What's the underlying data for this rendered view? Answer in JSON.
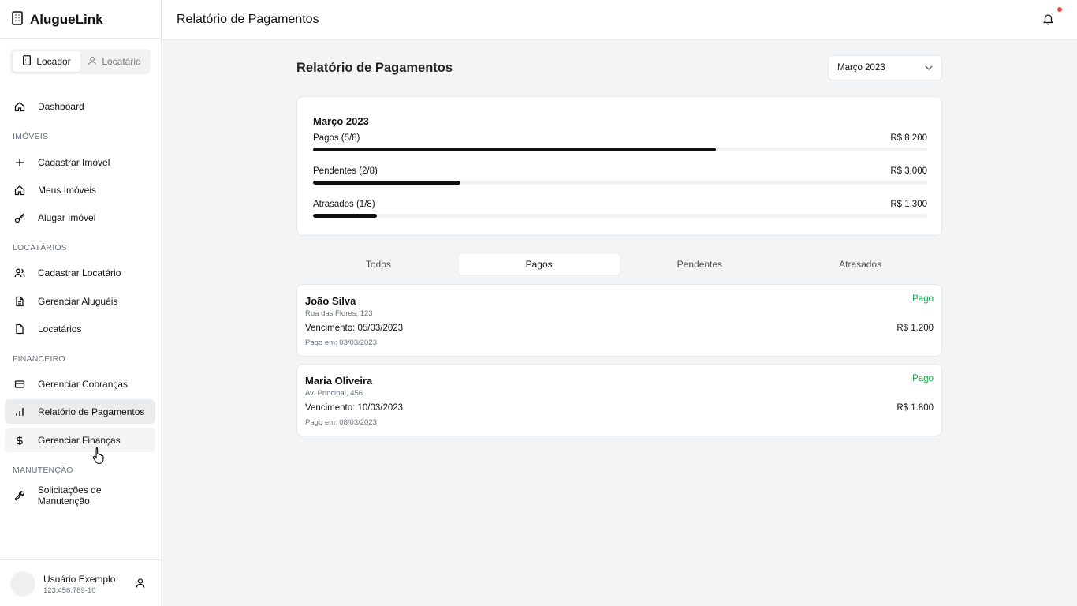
{
  "app": {
    "name": "AlugueLink"
  },
  "role_switch": {
    "landlord": "Locador",
    "tenant": "Locatário"
  },
  "nav": {
    "dashboard": "Dashboard",
    "sections": {
      "imoveis": "IMÓVEIS",
      "locatarios": "LOCATÁRIOS",
      "financeiro": "FINANCEIRO",
      "manutencao": "MANUTENÇÃO"
    },
    "items": {
      "cadastrar_imovel": "Cadastrar Imóvel",
      "meus_imoveis": "Meus Imóveis",
      "alugar_imovel": "Alugar Imóvel",
      "cadastrar_locatario": "Cadastrar Locatário",
      "gerenciar_alugueis": "Gerenciar Aluguéis",
      "locatarios": "Locatários",
      "gerenciar_cobrancas": "Gerenciar Cobranças",
      "relatorio_pagamentos": "Relatório de Pagamentos",
      "gerenciar_financas": "Gerenciar Finanças",
      "solicitacoes_manutencao": "Solicitações de Manutenção"
    }
  },
  "user": {
    "name": "Usuário Exemplo",
    "id": "123.456.789-10"
  },
  "header": {
    "title": "Relatório de Pagamentos"
  },
  "main": {
    "title": "Relatório de Pagamentos",
    "month_select": "Março 2023",
    "summary": {
      "title": "Março 2023",
      "rows": [
        {
          "label": "Pagos (5/8)",
          "amount": "R$ 8.200",
          "fraction": 0.656
        },
        {
          "label": "Pendentes (2/8)",
          "amount": "R$ 3.000",
          "fraction": 0.24
        },
        {
          "label": "Atrasados (1/8)",
          "amount": "R$ 1.300",
          "fraction": 0.104
        }
      ]
    },
    "tabs": [
      "Todos",
      "Pagos",
      "Pendentes",
      "Atrasados"
    ],
    "active_tab": "Pagos",
    "payments": [
      {
        "name": "João Silva",
        "address": "Rua das Flores, 123",
        "due": "Vencimento: 05/03/2023",
        "paid_on": "Pago em: 03/03/2023",
        "status": "Pago",
        "amount": "R$ 1.200"
      },
      {
        "name": "Maria Oliveira",
        "address": "Av. Principal, 456",
        "due": "Vencimento: 10/03/2023",
        "paid_on": "Pago em: 08/03/2023",
        "status": "Pago",
        "amount": "R$ 1.800"
      }
    ]
  },
  "colors": {
    "status_paid": "#16a34a",
    "notification_dot": "#ef4444",
    "progress_fill": "#111111"
  }
}
